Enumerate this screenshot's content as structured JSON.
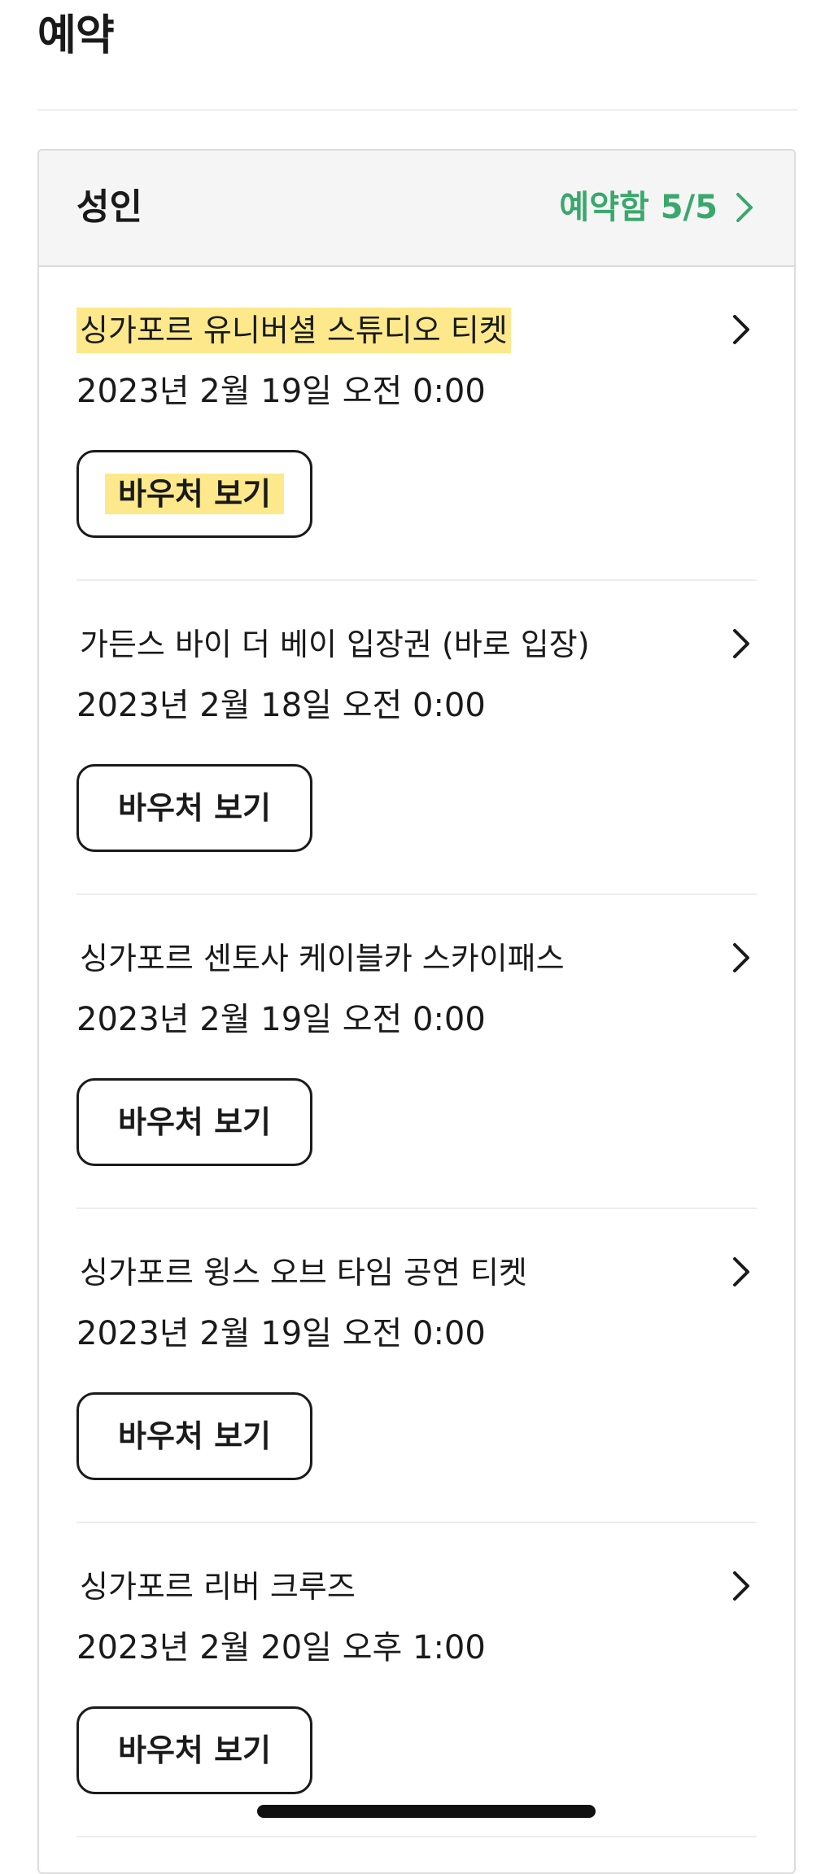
{
  "page": {
    "title": "예약"
  },
  "card": {
    "header_title": "성인",
    "status_label": "예약함 5/5"
  },
  "colors": {
    "accent_green": "#3aa76d",
    "highlight_yellow": "#fde98b"
  },
  "items": [
    {
      "title": "싱가포르 유니버셜 스튜디오 티켓",
      "date": "2023년 2월 19일 오전 0:00",
      "button_label": "바우처 보기",
      "highlighted": true
    },
    {
      "title": "가든스 바이 더 베이 입장권 (바로 입장)",
      "date": "2023년 2월 18일 오전 0:00",
      "button_label": "바우처 보기",
      "highlighted": false
    },
    {
      "title": "싱가포르 센토사 케이블카 스카이패스",
      "date": "2023년 2월 19일 오전 0:00",
      "button_label": "바우처 보기",
      "highlighted": false
    },
    {
      "title": "싱가포르 윙스 오브 타임 공연 티켓",
      "date": "2023년 2월 19일 오전 0:00",
      "button_label": "바우처 보기",
      "highlighted": false
    },
    {
      "title": "싱가포르 리버 크루즈",
      "date": "2023년 2월 20일 오후 1:00",
      "button_label": "바우처 보기",
      "highlighted": false
    }
  ],
  "icons": {
    "header_link": "chevron-right-icon",
    "item_link": "chevron-right-icon"
  }
}
